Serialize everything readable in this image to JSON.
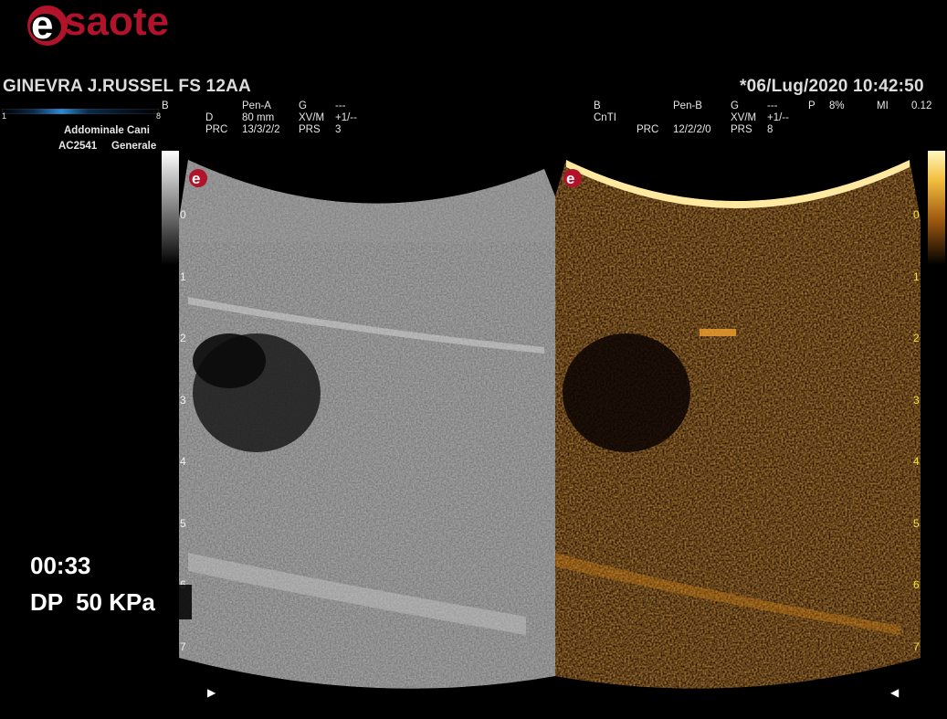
{
  "brand": {
    "name": "esaote",
    "logo_letter": "e"
  },
  "header": {
    "patient": "GINEVRA J.RUSSEL FS 12AA",
    "datetime": "*06/Lug/2020 10:42:50"
  },
  "left_panel": {
    "mode": "B",
    "color_scale_min": "1",
    "color_scale_max": "8",
    "preset": "Addominale Cani",
    "probe": "AC2541",
    "probe_preset": "Generale",
    "params": {
      "row1": [
        "Pen-A",
        "G",
        "---"
      ],
      "row2": [
        "D",
        "80 mm",
        "XV/M",
        "+1/--"
      ],
      "row3": [
        "PRC",
        "13/3/2/2",
        "PRS",
        "3"
      ]
    }
  },
  "right_panel": {
    "params": {
      "row1": [
        "B",
        "Pen-B",
        "G",
        "---",
        "P",
        "8%",
        "MI",
        "0.12"
      ],
      "row2": [
        "CnTI",
        "XV/M",
        "+1/--"
      ],
      "row3": [
        "PRC",
        "12/2/2/0",
        "PRS",
        "8"
      ]
    }
  },
  "overlay": {
    "timer": "00:33",
    "pressure": "DP  50 KPa"
  },
  "depth_scale": [
    "0",
    "1",
    "2",
    "3",
    "4",
    "5",
    "6",
    "7"
  ],
  "colors": {
    "brand_red": "#b0132a",
    "depth_yellow": "#f2e640",
    "contrast_orange": "#e08a18"
  },
  "icons": {
    "focus_left": "triangle-right-icon",
    "focus_right": "triangle-left-icon"
  }
}
